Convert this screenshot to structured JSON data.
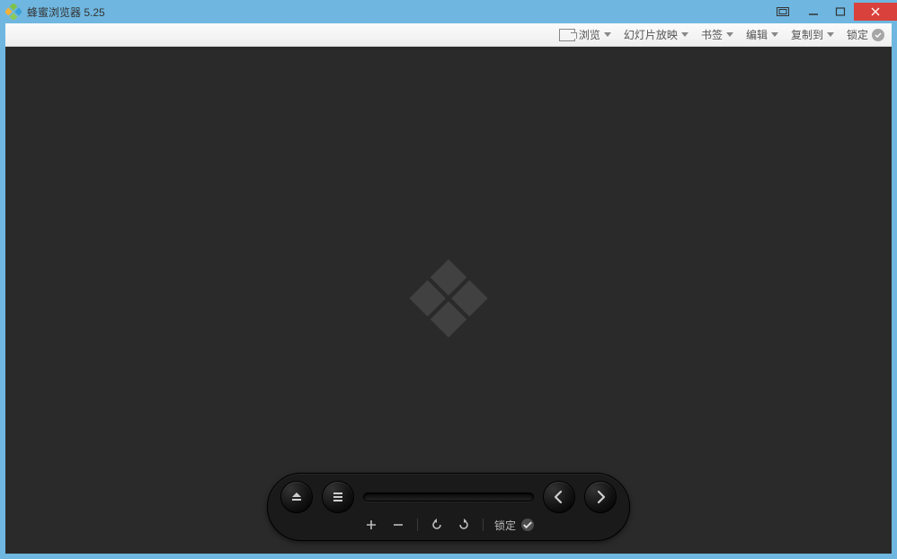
{
  "window": {
    "title": "蜂蜜浏览器 5.25"
  },
  "toolbar": {
    "browse": "浏览",
    "slideshow": "幻灯片放映",
    "bookmark": "书签",
    "edit": "编辑",
    "copyto": "复制到",
    "lock": "锁定"
  },
  "dock": {
    "lock_label": "锁定"
  }
}
